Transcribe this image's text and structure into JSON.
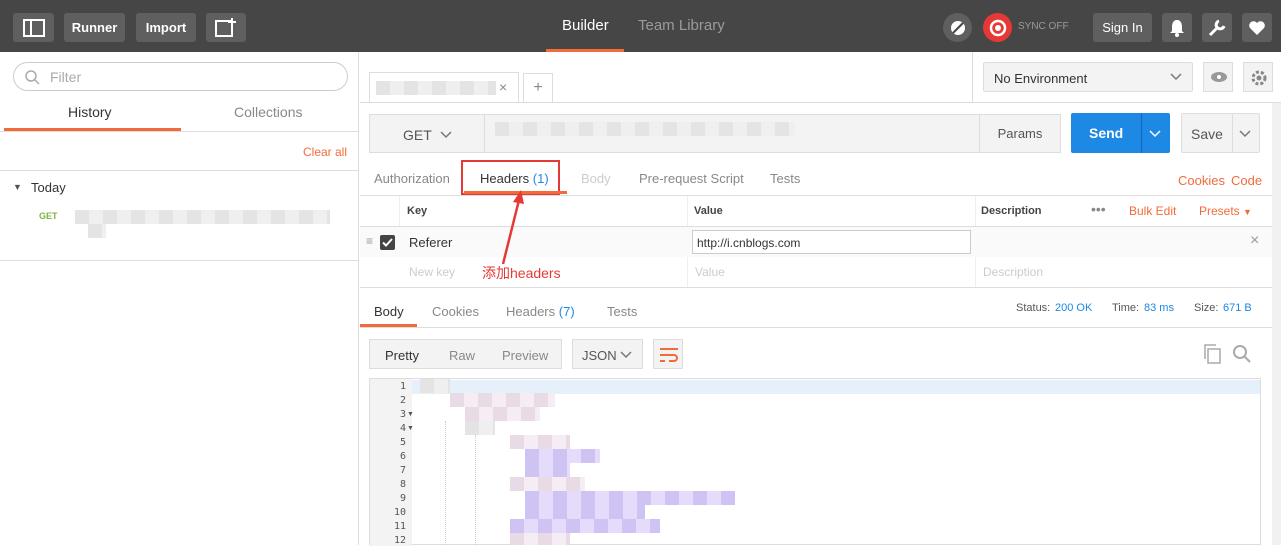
{
  "topbar": {
    "runner_label": "Runner",
    "import_label": "Import",
    "builder_tab": "Builder",
    "team_library_tab": "Team Library",
    "sync_status": "SYNC OFF",
    "sign_in_label": "Sign In"
  },
  "sidebar": {
    "filter_placeholder": "Filter",
    "tabs": [
      {
        "label": "History"
      },
      {
        "label": "Collections"
      }
    ],
    "clear_all": "Clear all",
    "group_label": "Today",
    "history_items": [
      {
        "method": "GET"
      }
    ]
  },
  "request": {
    "environment": "No Environment",
    "method": "GET",
    "params_label": "Params",
    "send_label": "Send",
    "save_label": "Save",
    "tabs": [
      {
        "label": "Authorization"
      },
      {
        "label": "Headers",
        "count": "(1)"
      },
      {
        "label": "Body"
      },
      {
        "label": "Pre-request Script"
      },
      {
        "label": "Tests"
      }
    ],
    "cookies_link": "Cookies",
    "code_link": "Code",
    "headers_table": {
      "columns": [
        "Key",
        "Value",
        "Description"
      ],
      "bulk_edit": "Bulk Edit",
      "presets": "Presets",
      "rows": [
        {
          "key": "Referer",
          "value": "http://i.cnblogs.com"
        }
      ],
      "new_key_placeholder": "New key",
      "value_placeholder": "Value",
      "description_placeholder": "Description"
    },
    "annotation": "添加headers"
  },
  "response": {
    "tabs": [
      {
        "label": "Body"
      },
      {
        "label": "Cookies"
      },
      {
        "label": "Headers",
        "count": "(7)"
      },
      {
        "label": "Tests"
      }
    ],
    "status_label": "Status:",
    "status_value": "200 OK",
    "time_label": "Time:",
    "time_value": "83 ms",
    "size_label": "Size:",
    "size_value": "671 B",
    "view_modes": [
      "Pretty",
      "Raw",
      "Preview"
    ],
    "format": "JSON",
    "line_numbers": [
      "1",
      "2",
      "3",
      "4",
      "5",
      "6",
      "7",
      "8",
      "9",
      "10",
      "11",
      "12"
    ]
  },
  "colors": {
    "accent": "#f26b3a",
    "send": "#1e88e5",
    "topbar": "#464646",
    "annotation": "#e53935"
  }
}
